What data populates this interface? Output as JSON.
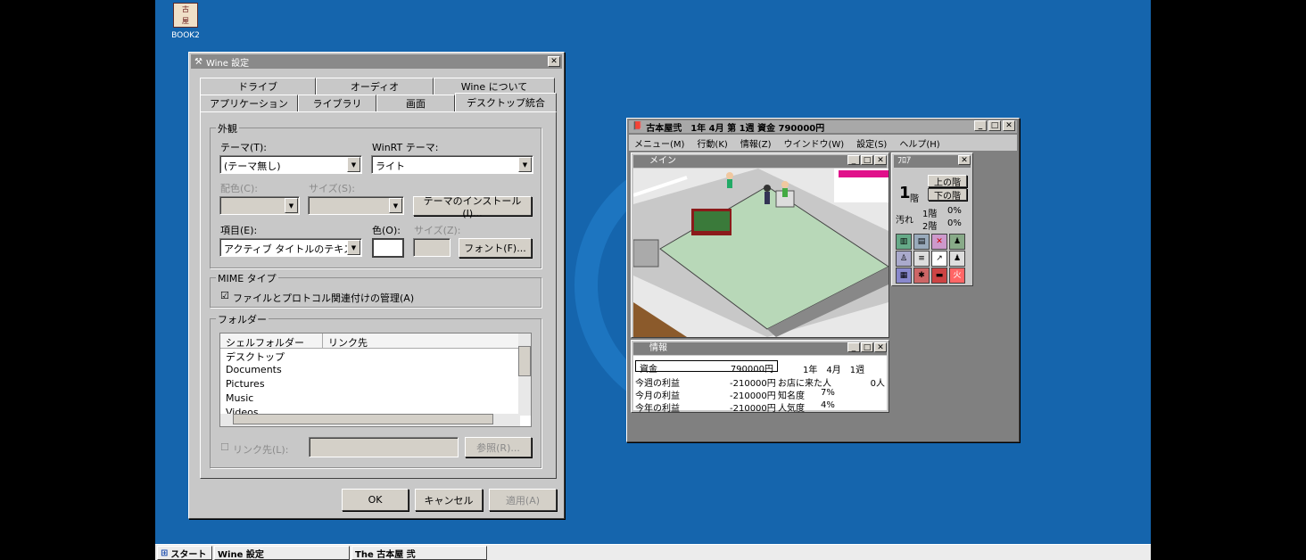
{
  "desktop": {
    "icon_label": "BOOK2"
  },
  "wine": {
    "title": "Wine 設定",
    "tabs_row1": [
      "ドライブ",
      "オーディオ",
      "Wine について"
    ],
    "tabs_row2": [
      "アプリケーション",
      "ライブラリ",
      "画面",
      "デスクトップ統合"
    ],
    "appearance": {
      "group": "外観",
      "theme_label": "テーマ(T):",
      "theme_value": "(テーマ無し)",
      "winrt_label": "WinRT テーマ:",
      "winrt_value": "ライト",
      "color_label": "配色(C):",
      "size_label": "サイズ(S):",
      "install_button": "テーマのインストール(I)...",
      "item_label": "項目(E):",
      "item_value": "アクティブ タイトルのテキス",
      "colour_label": "色(O):",
      "size2_label": "サイズ(Z):",
      "font_button": "フォント(F)..."
    },
    "mime": {
      "group": "MIME タイプ",
      "checkbox": "ファイルとプロトコル関連付けの管理(A)"
    },
    "folders": {
      "group": "フォルダー",
      "col1": "シェルフォルダー",
      "col2": "リンク先",
      "rows": [
        "デスクトップ",
        "Documents",
        "Pictures",
        "Music",
        "Videos"
      ],
      "link_check": "リンク先(L):",
      "browse": "参照(R)..."
    },
    "ok": "OK",
    "cancel": "キャンセル",
    "apply": "適用(A)"
  },
  "game": {
    "title": "古本屋弐　1年 4月 第 1週 資金 790000円",
    "menu": [
      "メニュー(M)",
      "行動(K)",
      "情報(Z)",
      "ウインドウ(W)",
      "設定(S)",
      "ヘルプ(H)"
    ],
    "main_title": "メイン",
    "info_title": "情報",
    "floor_title": "ﾌﾛｱ",
    "floor": {
      "num": "1",
      "unit": "階",
      "up": "上の階",
      "down": "下の階",
      "dirt": "汚れ",
      "f1": "1階",
      "f1v": "0%",
      "f2": "2階",
      "f2v": "0%"
    },
    "info": {
      "funds_label": "資金",
      "funds": "790000円",
      "date": "1年　4月　1週",
      "rows": [
        {
          "l": "今週の利益",
          "v": "-210000円",
          "l2": "お店に来た人",
          "v2": "0人"
        },
        {
          "l": "今月の利益",
          "v": "-210000円",
          "l2": "知名度",
          "v2": "7%"
        },
        {
          "l": "今年の利益",
          "v": "-210000円",
          "l2": "人気度",
          "v2": "4%"
        }
      ]
    }
  },
  "taskbar": {
    "start": "スタート",
    "items": [
      "Wine 設定",
      "The 古本屋 弐"
    ]
  }
}
